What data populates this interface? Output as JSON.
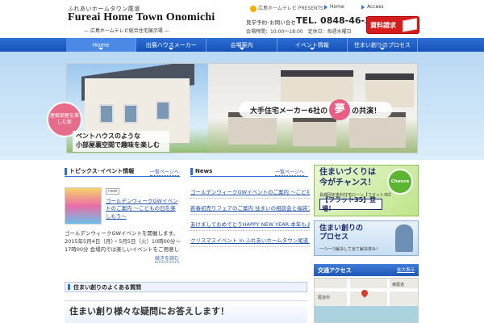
{
  "header": {
    "logo_sub": "ふれあいホームタウン尾道",
    "logo_main": "Fureai Home Town Onomichi",
    "logo_tag": "— 広島ホームテレビ総合住宅展示場 —",
    "presents": "広島ホームテレビ PRESENTS",
    "home_link": "Home",
    "access_link": "Access",
    "phone_label": "見学予約･お問い合せ",
    "phone": "TEL. 0848-46-3400",
    "hours": "会場時間：10:00～18:00　定休日：毎週水曜日",
    "request_button": "資料請求"
  },
  "nav": {
    "items": [
      "Home",
      "出展ハウスメーカー",
      "会場案内",
      "イベント情報",
      "住まい創りのプロセス"
    ],
    "active": "Home"
  },
  "hero": {
    "bubble": "屋根部屋を楽しむ家",
    "caption_line1": "ペントハウスのような",
    "caption_line2": "小部屋裏空間で趣味を楽しむ",
    "banner_pre": "大手住宅メーカー6社の",
    "banner_accent": "夢",
    "banner_post": "の共演！"
  },
  "topics": {
    "title": "トピックス･イベント情報",
    "more": "一覧ページへ",
    "new_tag": "new",
    "headline": "ゴールデンウィークGWイベントのご案内 ～こどもの日を楽しもう～",
    "body": "ゴールデンウィークGWイベントを開催します。2015年5月4日（月）・5月5日（火）10時00分～17時00分 会場内では楽しいイベントをご用意しております。みなさまのご来場をお待ちしております。",
    "more_link": "続きを読む"
  },
  "news": {
    "title": "News",
    "more": "一覧ページへ",
    "items": [
      "ゴールデンウィークGWイベントのご案内 ～こどもの日を楽しもう～",
      "新春初売りフェアのご案内 住まいの相談会と福袋プレゼント",
      "あけましておめでとうHAPPY NEW YEAR 本年もよろしくお願いいたします",
      "クリスマスイベント in ふれあいホームタウン尾道 開催のお知らせ"
    ]
  },
  "faq_bar": "住まい創りのよくある質問",
  "faq_banner": "住まい創り様々な疑問にお答えします！",
  "side": {
    "chance_line1": "住まいづくりは",
    "chance_line2": "今がチャンス！",
    "chance_small": "長期固定金利住宅ローン【フラット35】",
    "flat35": "【フラット35】登場！",
    "chance_badge": "Chance",
    "process_line1": "住まい創りの",
    "process_line2": "プロセス",
    "process_small": "一つ一つ解決して全て解決済み！",
    "access_title": "交通アクセス",
    "access_more": "拡大表示",
    "map_label1": "東尾道",
    "map_label2": "尾道市"
  }
}
